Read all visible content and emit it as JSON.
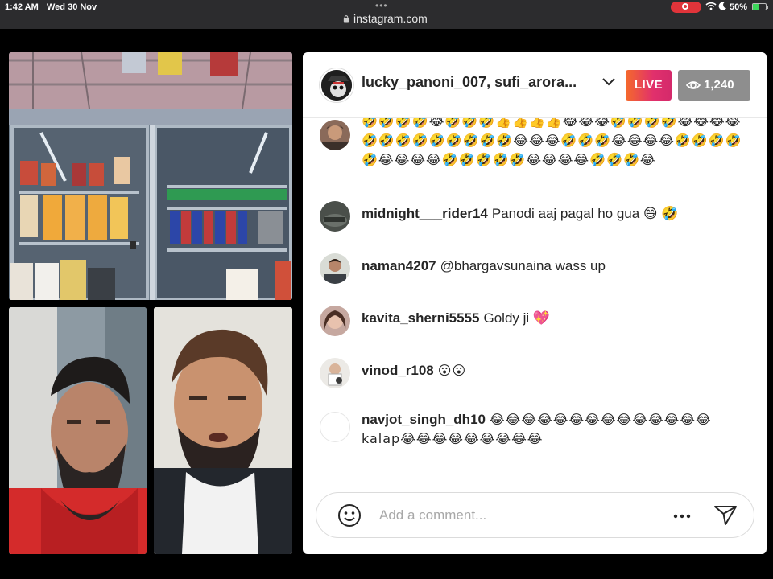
{
  "status_bar": {
    "time": "1:42 AM",
    "date": "Wed 30 Nov",
    "url": "instagram.com",
    "battery": "50%",
    "battery_level": 0.5
  },
  "live": {
    "host_names": "lucky_panoni_007, sufi_arora...",
    "badge": "LIVE",
    "viewers": "1,240"
  },
  "comments": [
    {
      "user": "",
      "text": "🤣🤣🤣🤣😂🤣🤣🤣👍👍👍👍😂😂😂🤣🤣🤣🤣😂😂😂😂🤣🤣🤣🤣🤣🤣🤣🤣🤣😂😂😂🤣🤣🤣😂😂😂😂🤣🤣🤣🤣🤣😂😂😂😂🤣🤣🤣🤣🤣😂😂😂😂🤣🤣🤣😂"
    },
    {
      "user": "midnight___rider14",
      "text": "Panodi aaj pagal ho gua 😄 🤣"
    },
    {
      "user": "naman4207",
      "text": "@bhargavsunaina wass up"
    },
    {
      "user": "kavita_sherni5555",
      "text": "Goldy ji 💖"
    },
    {
      "user": "vinod_r108",
      "text": "😮😮"
    },
    {
      "user": "navjot_singh_dh10",
      "text": "😂😂😂😂😂😂😂😂😂😂😂😂😂😂kalap😂😂😂😂😂😂😂😂😂"
    }
  ],
  "footer": {
    "placeholder": "Add a comment..."
  },
  "colors": {
    "live_gradient_start": "#f56a2b",
    "live_gradient_end": "#d42a6b",
    "viewer_badge": "#8e8e8e",
    "record_indicator": "#e0343a"
  }
}
